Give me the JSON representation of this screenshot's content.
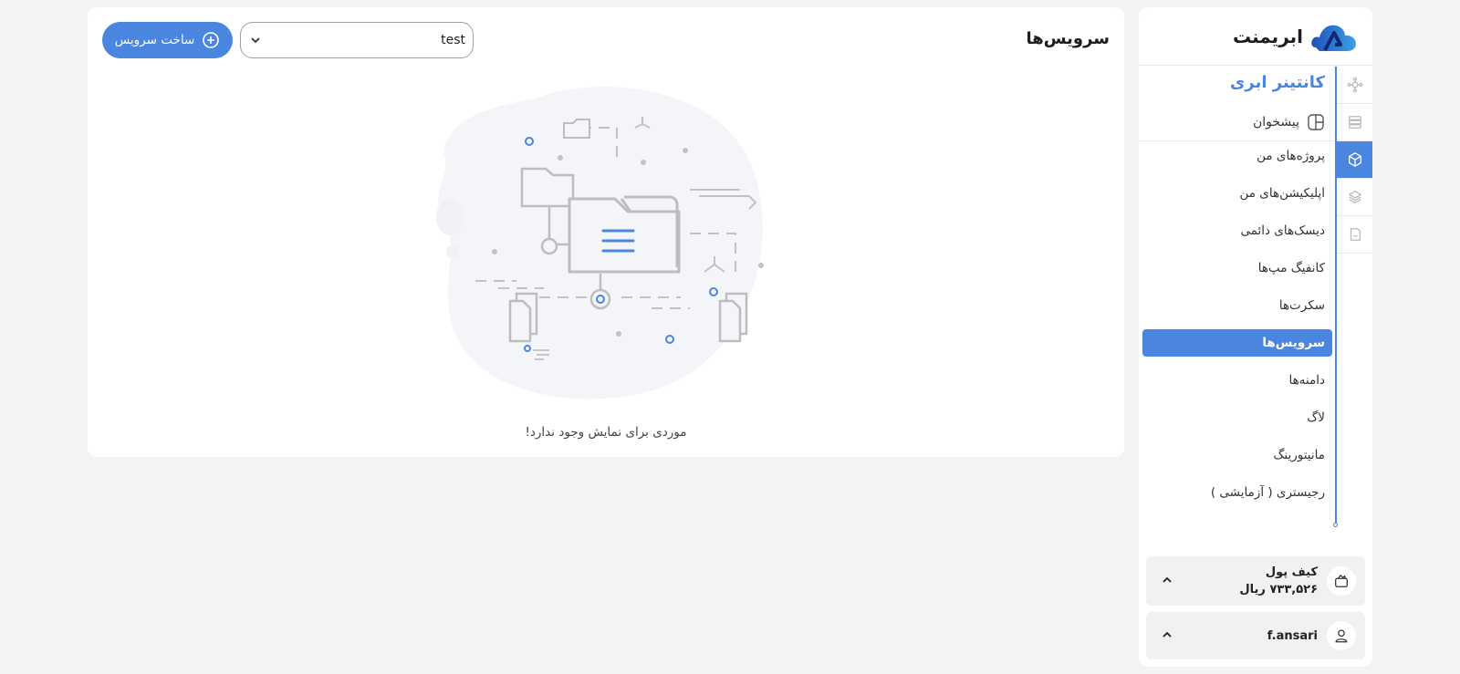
{
  "brand": {
    "name": "ابریمنت"
  },
  "sidebar": {
    "section_title": "کانتینر ابری",
    "dashboard_label": "پیشخوان",
    "items": [
      {
        "label": "پروژه‌های من"
      },
      {
        "label": "اپلیکیشن‌های من"
      },
      {
        "label": "دیسک‌های دائمی"
      },
      {
        "label": "کانفیگ مپ‌ها"
      },
      {
        "label": "سکرت‌ها"
      },
      {
        "label": "سرویس‌ها",
        "active": true
      },
      {
        "label": "دامنه‌ها"
      },
      {
        "label": "لاگ"
      },
      {
        "label": "مانیتورینگ"
      },
      {
        "label": "رجیستری ( آزمایشی )"
      }
    ],
    "rail_icons": [
      "cloud-network-icon",
      "server-icon",
      "container-cube-icon",
      "layers-icon",
      "storage-icon"
    ],
    "wallet": {
      "title": "کیف پول",
      "balance": "۷۳۳,۵۲۶ ریال"
    },
    "user": {
      "name": "f.ansari"
    }
  },
  "main": {
    "title": "سرویس‌ها",
    "create_button_label": "ساخت سرویس",
    "project_select": {
      "value": "test"
    },
    "empty_message": "موردی برای نمایش وجود ندارد!"
  },
  "colors": {
    "accent": "#4a86e0",
    "background": "#f3f3f3",
    "panel": "#ffffff"
  }
}
